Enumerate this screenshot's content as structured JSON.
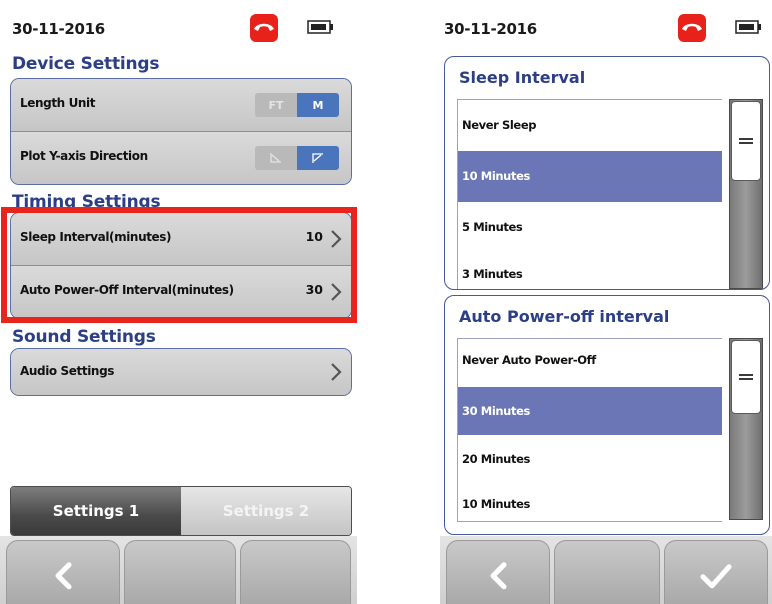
{
  "left_screen": {
    "status": {
      "date": "30-11-2016",
      "phone_icon": "phone-hangup-icon",
      "battery_icon": "battery-icon",
      "phone_icon_color": "#e8221b"
    },
    "device_settings": {
      "title": "Device Settings",
      "rows": [
        {
          "label": "Length Unit",
          "options": [
            "FT",
            "M"
          ],
          "selected": "M"
        },
        {
          "label": "Plot Y-axis Direction",
          "options": [
            "down-axis-icon",
            "up-axis-icon"
          ],
          "selected": "up-axis-icon"
        }
      ]
    },
    "timing_settings": {
      "title": "Timing Settings",
      "rows": [
        {
          "label": "Sleep Interval(minutes)",
          "value": "10"
        },
        {
          "label": "Auto Power-Off Interval(minutes)",
          "value": "30"
        }
      ]
    },
    "sound_settings": {
      "title": "Sound Settings",
      "rows": [
        {
          "label": "Audio Settings"
        }
      ]
    },
    "tabs": [
      {
        "label": "Settings 1",
        "active": true
      },
      {
        "label": "Settings 2",
        "active": false
      }
    ],
    "softkeys": [
      "back-arrow-icon",
      "",
      ""
    ],
    "highlight_color": "#e8241c",
    "accent_color": "#2c3f86"
  },
  "right_screen": {
    "status": {
      "date": "30-11-2016",
      "phone_icon": "phone-hangup-icon",
      "battery_icon": "battery-icon"
    },
    "sleep_picker": {
      "title": "Sleep Interval",
      "options": [
        "Never Sleep",
        "10 Minutes",
        "5 Minutes",
        "3 Minutes"
      ],
      "selected": "10 Minutes"
    },
    "power_off_picker": {
      "title": "Auto Power-off interval",
      "options": [
        "Never Auto Power-Off",
        "30 Minutes",
        "20 Minutes",
        "10 Minutes"
      ],
      "selected": "30 Minutes"
    },
    "softkeys": [
      "back-arrow-icon",
      "",
      "checkmark-icon"
    ],
    "selection_color": "#6b76b6"
  }
}
